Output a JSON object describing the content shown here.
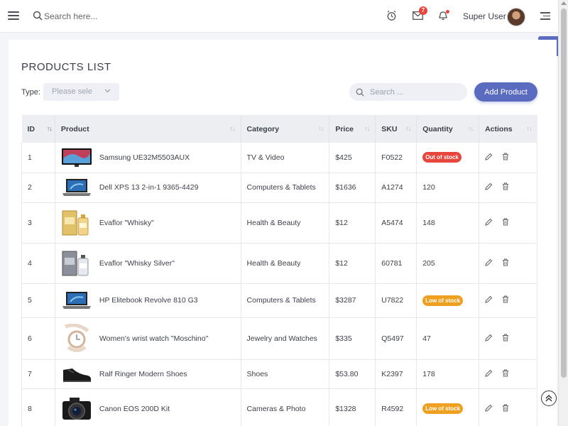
{
  "header": {
    "search_placeholder": "Search here...",
    "messages_count": "7",
    "user_name": "Super User"
  },
  "page": {
    "title": "PRODUCTS LIST",
    "type_label": "Type:",
    "type_placeholder": "Please sele",
    "search_placeholder": "Search ...",
    "add_button": "Add Product"
  },
  "table": {
    "columns": [
      "ID",
      "Product",
      "Category",
      "Price",
      "SKU",
      "Quantity",
      "Actions"
    ],
    "rows": [
      {
        "id": "1",
        "product": "Samsung UE32M5503AUX",
        "category": "TV & Video",
        "price": "$425",
        "sku": "F0522",
        "quantity": "Out of stock",
        "status": "out",
        "image": "tv-image"
      },
      {
        "id": "2",
        "product": "Dell XPS 13 2-in-1 9365-4429",
        "category": "Computers & Tablets",
        "price": "$1636",
        "sku": "A1274",
        "quantity": "120",
        "status": "",
        "image": "laptop-image"
      },
      {
        "id": "3",
        "product": "Evaflor \"Whisky\"",
        "category": "Health & Beauty",
        "price": "$12",
        "sku": "A5474",
        "quantity": "148",
        "status": "",
        "image": "perfume-image"
      },
      {
        "id": "4",
        "product": "Evaflor \"Whisky Silver\"",
        "category": "Health & Beauty",
        "price": "$12",
        "sku": "60781",
        "quantity": "205",
        "status": "",
        "image": "perfume-silver-image"
      },
      {
        "id": "5",
        "product": "HP Elitebook Revolve 810 G3",
        "category": "Computers & Tablets",
        "price": "$3287",
        "sku": "U7822",
        "quantity": "Low of stock",
        "status": "low",
        "image": "laptop-image"
      },
      {
        "id": "6",
        "product": "Women's wrist watch \"Moschino\"",
        "category": "Jewelry and Watches",
        "price": "$335",
        "sku": "Q5497",
        "quantity": "47",
        "status": "",
        "image": "watch-image"
      },
      {
        "id": "7",
        "product": "Ralf Ringer Modern Shoes",
        "category": "Shoes",
        "price": "$53.80",
        "sku": "K2397",
        "quantity": "178",
        "status": "",
        "image": "shoe-image"
      },
      {
        "id": "8",
        "product": "Canon EOS 200D Kit",
        "category": "Cameras & Photo",
        "price": "$1328",
        "sku": "R4592",
        "quantity": "Low of stock",
        "status": "low",
        "image": "camera-image"
      }
    ]
  },
  "colors": {
    "accent": "#5b6bc0",
    "out_of_stock": "#e8453c",
    "low_stock": "#f0a020"
  }
}
